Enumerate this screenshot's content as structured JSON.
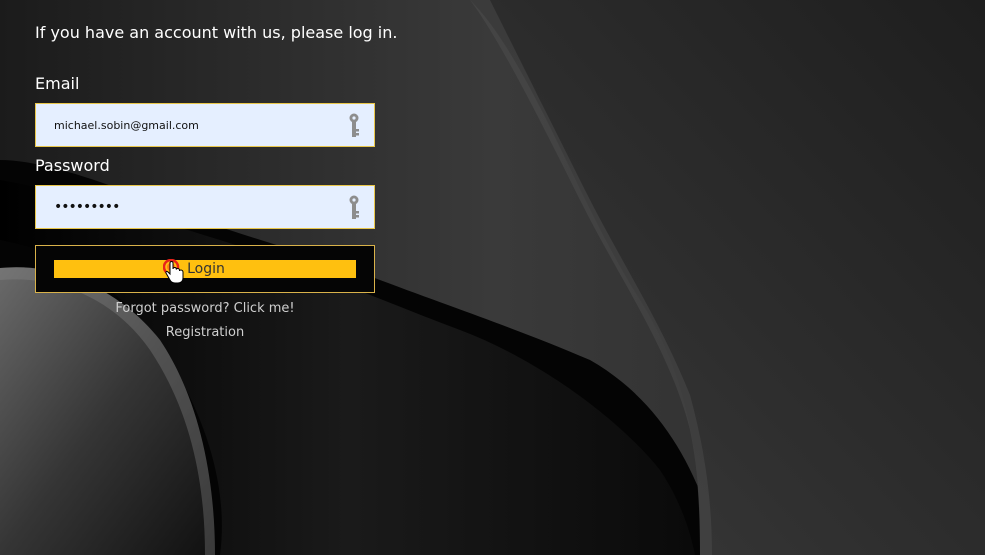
{
  "login_form": {
    "intro_text": "If you have an account with us, please log in.",
    "email_label": "Email",
    "email_value": "michael.sobin@gmail.com",
    "password_label": "Password",
    "password_value": "•••••••••",
    "field_icon": "key-icon",
    "login_label": "Login",
    "forgot_link": "Forgot password? Click me!",
    "registration_link": "Registration"
  },
  "colors": {
    "background": "#000000",
    "field_background": "#e5efff",
    "field_border": "#e8c64a",
    "button_accent": "#ffc00f",
    "link_text": "#cfcfcf"
  },
  "cursor": "hand-pointer-icon"
}
